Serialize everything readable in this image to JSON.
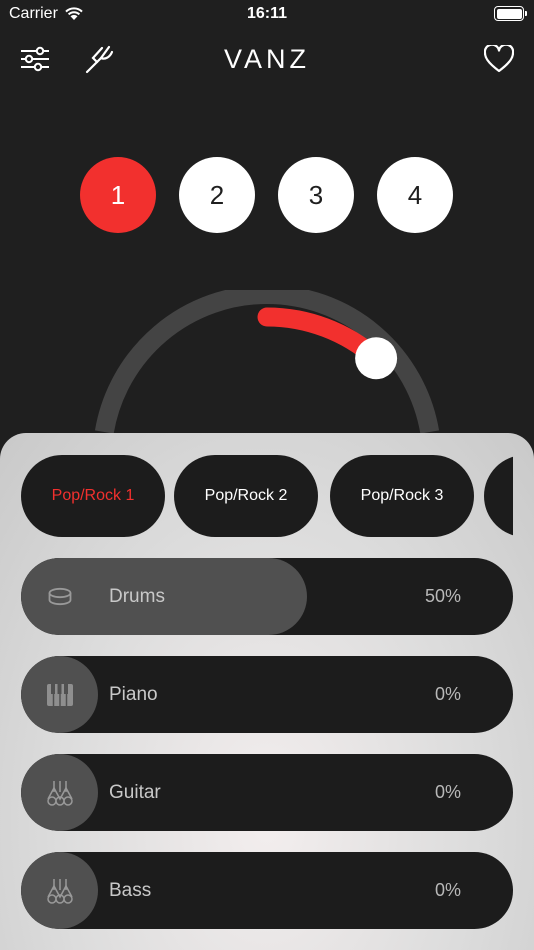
{
  "status": {
    "carrier": "Carrier",
    "time": "16:11"
  },
  "nav": {
    "title": "VANZ"
  },
  "presets": [
    {
      "label": "1",
      "active": true
    },
    {
      "label": "2",
      "active": false
    },
    {
      "label": "3",
      "active": false
    },
    {
      "label": "4",
      "active": false
    }
  ],
  "dial": {
    "level_fraction": 0.12
  },
  "styles": [
    {
      "label": "Pop/Rock 1",
      "active": true
    },
    {
      "label": "Pop/Rock 2",
      "active": false
    },
    {
      "label": "Pop/Rock 3",
      "active": false
    }
  ],
  "tracks": [
    {
      "name": "Drums",
      "percent": "50%",
      "level": 0.5,
      "icon": "drum-icon"
    },
    {
      "name": "Piano",
      "percent": "0%",
      "level": 0,
      "icon": "piano-icon"
    },
    {
      "name": "Guitar",
      "percent": "0%",
      "level": 0,
      "icon": "guitar-icon"
    },
    {
      "name": "Bass",
      "percent": "0%",
      "level": 0,
      "icon": "bass-icon"
    }
  ],
  "colors": {
    "accent": "#f2302e",
    "background": "#1f1f1f",
    "pill": "#1c1c1c",
    "track_fill": "#505050"
  }
}
